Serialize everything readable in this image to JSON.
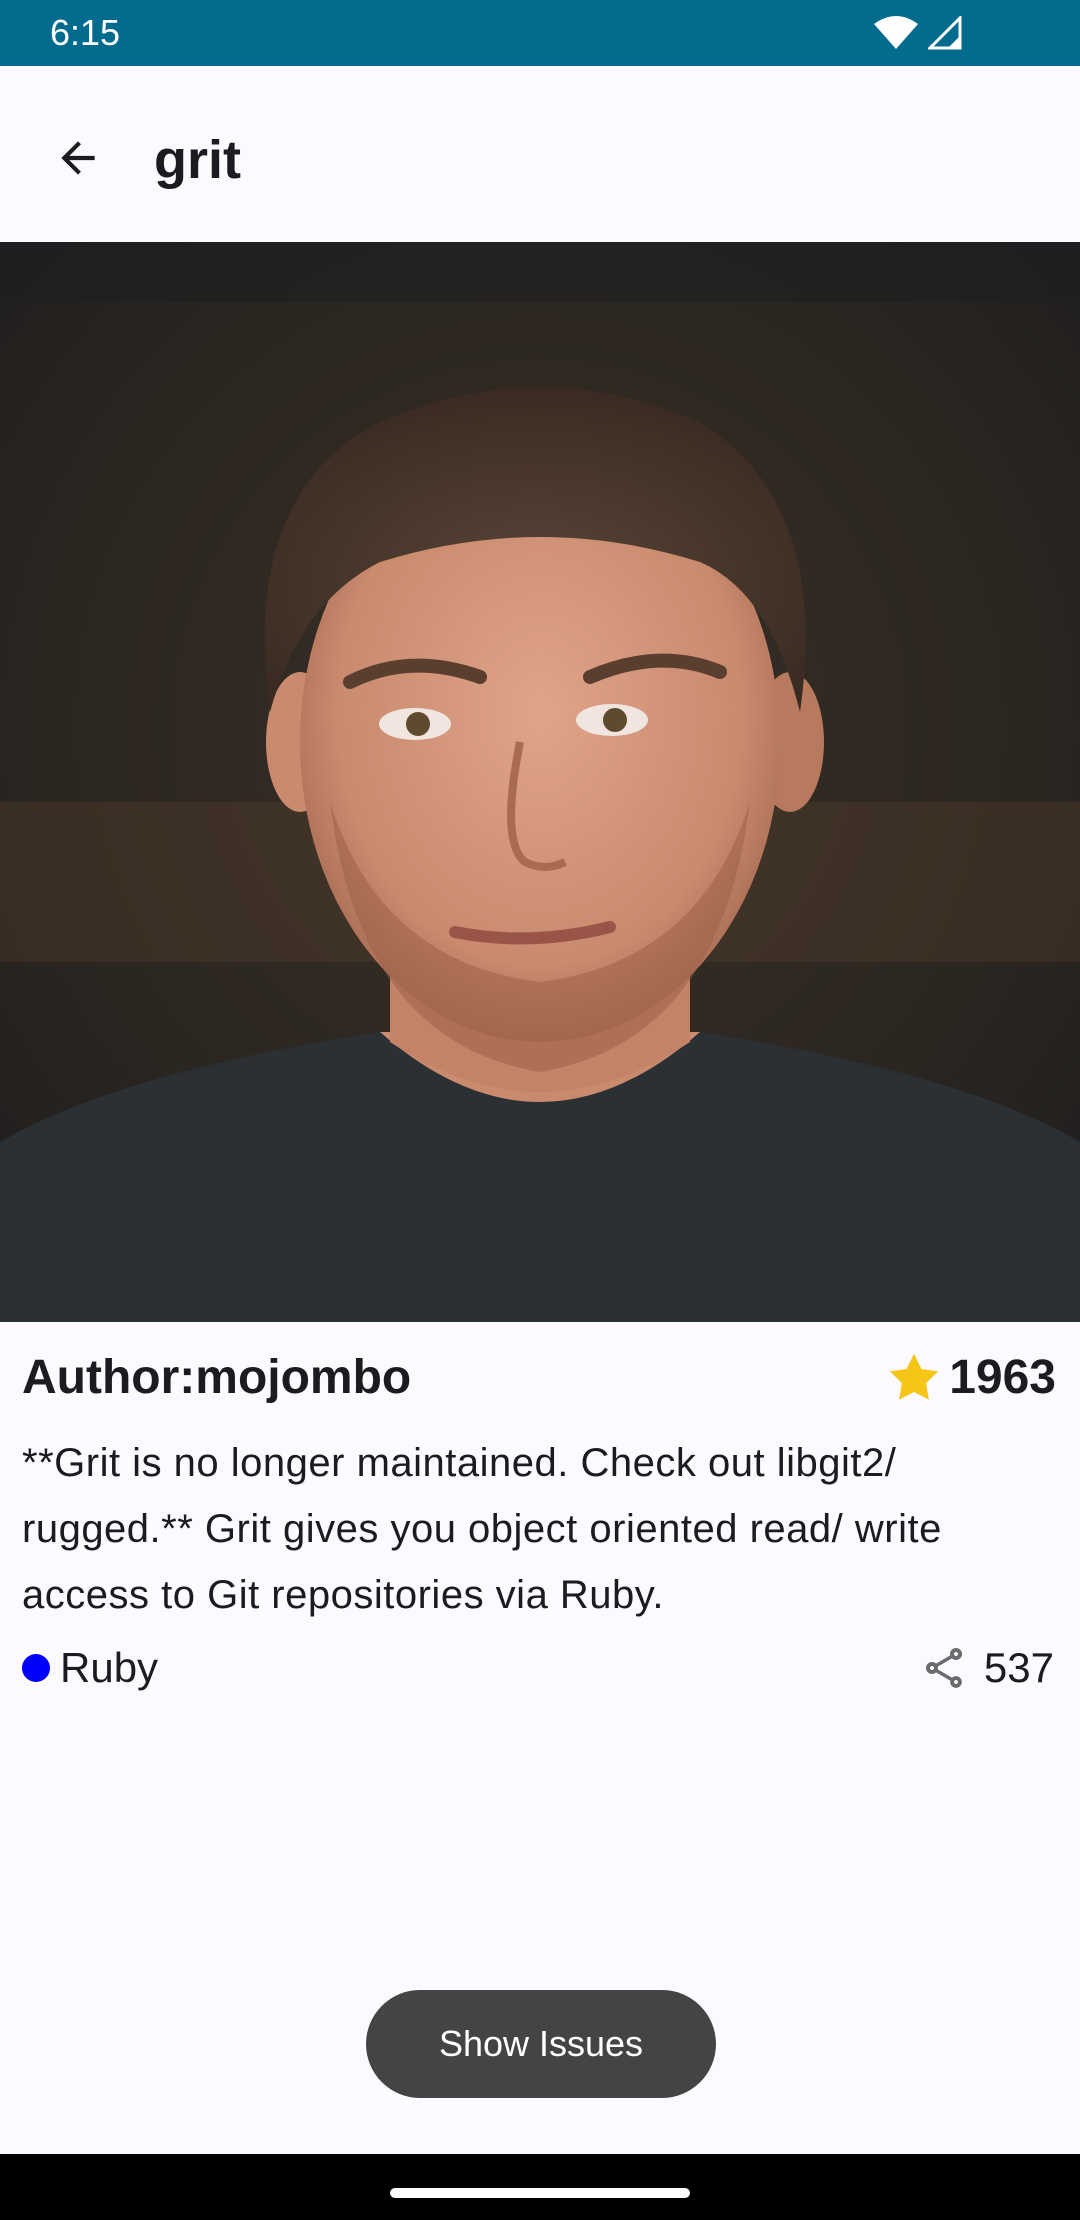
{
  "status_bar": {
    "time": "6:15"
  },
  "app_bar": {
    "title": "grit"
  },
  "repo": {
    "author": "Author:mojombo",
    "stars": "1963",
    "description": "**Grit is no longer maintained. Check out libgit2/ rugged.** Grit gives you object oriented read/ write access to Git repositories via Ruby.",
    "language": "Ruby",
    "forks": "537"
  },
  "actions": {
    "show_issues": "Show Issues"
  },
  "colors": {
    "status_bar": "#026b8e",
    "language_dot": "#0000ff",
    "star": "#f5c518",
    "button": "#444444"
  }
}
